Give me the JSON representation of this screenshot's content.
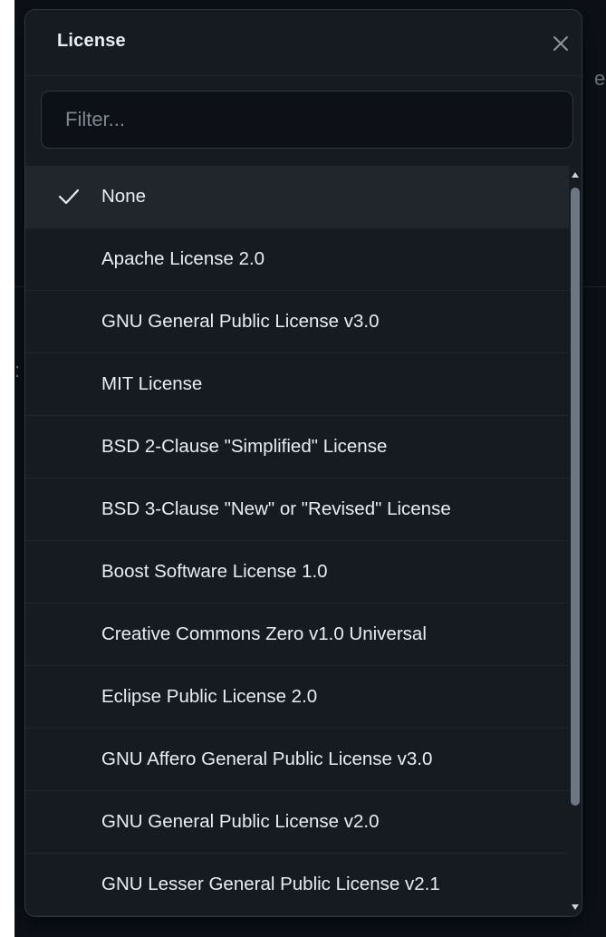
{
  "dialog": {
    "title": "License",
    "close_icon": "close-icon"
  },
  "filter": {
    "placeholder": "Filter...",
    "value": ""
  },
  "background": {
    "fragment_right": "e",
    "fragment_left": ":"
  },
  "licenses": {
    "selected_index": 0,
    "items": [
      {
        "label": "None"
      },
      {
        "label": "Apache License 2.0"
      },
      {
        "label": "GNU General Public License v3.0"
      },
      {
        "label": "MIT License"
      },
      {
        "label": "BSD 2-Clause \"Simplified\" License"
      },
      {
        "label": "BSD 3-Clause \"New\" or \"Revised\" License"
      },
      {
        "label": "Boost Software License 1.0"
      },
      {
        "label": "Creative Commons Zero v1.0 Universal"
      },
      {
        "label": "Eclipse Public License 2.0"
      },
      {
        "label": "GNU Affero General Public License v3.0"
      },
      {
        "label": "GNU General Public License v2.0"
      },
      {
        "label": "GNU Lesser General Public License v2.1"
      }
    ]
  },
  "colors": {
    "page_bg": "#0d1117",
    "panel_bg": "#161b22",
    "border": "#30363d",
    "text": "#e6edf3",
    "muted": "#7d8590",
    "selected_bg": "#21262d"
  }
}
